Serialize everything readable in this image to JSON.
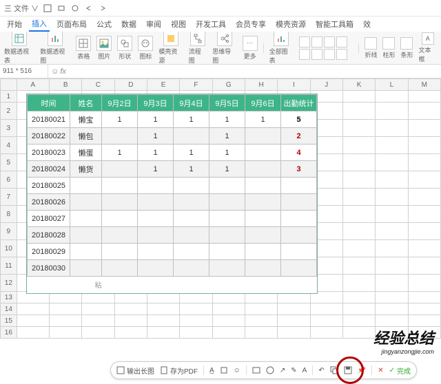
{
  "title_bar": {
    "doc": "三 文件 ∨"
  },
  "menu": {
    "items": [
      "开始",
      "插入",
      "页面布局",
      "公式",
      "数据",
      "审阅",
      "视图",
      "开发工具",
      "会员专享",
      "模壳资源",
      "智能工具箱",
      "效"
    ],
    "active": 1
  },
  "ribbon": {
    "groups": [
      "数据透视表",
      "数据透视图",
      "表格",
      "图片",
      "形状",
      "图标",
      "模壳资源",
      "流程图",
      "思维导图",
      "更多"
    ],
    "chart_labels": [
      "折线",
      "柱形",
      "条形",
      "文本框"
    ],
    "chart_group": "全部图表"
  },
  "formula": {
    "name_box": "911 * 516",
    "fx": "fx"
  },
  "cols": [
    "",
    "A",
    "B",
    "C",
    "D",
    "E",
    "F",
    "G",
    "H",
    "I",
    "J",
    "K",
    "L",
    "M"
  ],
  "rows": [
    "1",
    "2",
    "3",
    "4",
    "5",
    "6",
    "7",
    "8",
    "9",
    "10",
    "11",
    "12",
    "13",
    "14",
    "15",
    "16"
  ],
  "inner": {
    "headers": [
      "时间",
      "姓名",
      "9月2日",
      "9月3日",
      "9月4日",
      "9月5日",
      "9月6日",
      "出勤统计"
    ],
    "data": [
      [
        "20180021",
        "懒宝",
        "1",
        "1",
        "1",
        "1",
        "1",
        "5"
      ],
      [
        "20180022",
        "懒包",
        "",
        "1",
        "",
        "1",
        "",
        "2"
      ],
      [
        "20180023",
        "懒蛋",
        "1",
        "1",
        "1",
        "1",
        "",
        "4"
      ],
      [
        "20180024",
        "懒货",
        "",
        "1",
        "1",
        "1",
        "",
        "3"
      ],
      [
        "20180025",
        "",
        "",
        "",
        "",
        "",
        "",
        ""
      ],
      [
        "20180026",
        "",
        "",
        "",
        "",
        "",
        "",
        ""
      ],
      [
        "20180027",
        "",
        "",
        "",
        "",
        "",
        "",
        ""
      ],
      [
        "20180028",
        "",
        "",
        "",
        "",
        "",
        "",
        ""
      ],
      [
        "20180029",
        "",
        "",
        "",
        "",
        "",
        "",
        ""
      ],
      [
        "20180030",
        "",
        "",
        "",
        "",
        "",
        "",
        ""
      ]
    ],
    "paste_hint": "粘"
  },
  "toolbar": {
    "export_img": "输出长图",
    "save_pdf": "存为PDF",
    "done": "完成"
  },
  "watermark": {
    "title": "经验总结",
    "sub": "jingyanzongjie.com"
  }
}
